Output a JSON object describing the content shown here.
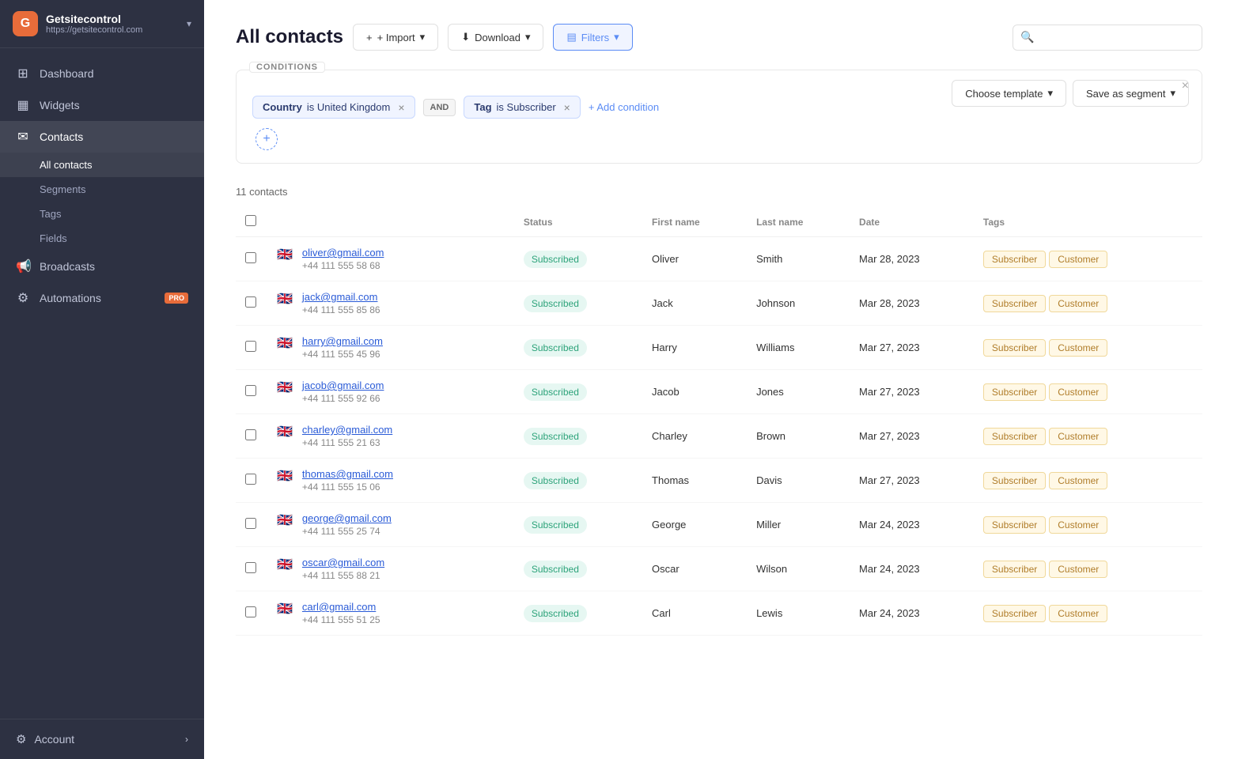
{
  "brand": {
    "name": "Getsitecontrol",
    "url": "https://getsitecontrol.com",
    "icon_label": "G"
  },
  "sidebar": {
    "nav_items": [
      {
        "id": "dashboard",
        "label": "Dashboard",
        "icon": "⊞"
      },
      {
        "id": "widgets",
        "label": "Widgets",
        "icon": "▦"
      },
      {
        "id": "contacts",
        "label": "Contacts",
        "icon": "✉",
        "active": true
      }
    ],
    "contacts_sub": [
      {
        "id": "all-contacts",
        "label": "All contacts",
        "active": true
      },
      {
        "id": "segments",
        "label": "Segments"
      },
      {
        "id": "tags",
        "label": "Tags"
      },
      {
        "id": "fields",
        "label": "Fields"
      }
    ],
    "nav_bottom": [
      {
        "id": "broadcasts",
        "label": "Broadcasts",
        "icon": "📢"
      },
      {
        "id": "automations",
        "label": "Automations",
        "icon": "⚙",
        "pro": true
      }
    ],
    "account": {
      "label": "Account",
      "icon": "⚙"
    }
  },
  "header": {
    "title": "All contacts",
    "import_label": "+ Import",
    "download_label": "⬇ Download",
    "filters_label": "⊞ Filters",
    "search_placeholder": ""
  },
  "conditions": {
    "label": "CONDITIONS",
    "choose_template": "Choose template",
    "save_as_segment": "Save as segment",
    "condition1": {
      "field": "Country",
      "operator": "is",
      "value": "United Kingdom"
    },
    "and_label": "AND",
    "condition2": {
      "field": "Tag",
      "operator": "is",
      "value": "Subscriber"
    },
    "add_condition_label": "+ Add condition"
  },
  "table": {
    "contact_count": "11 contacts",
    "columns": [
      "",
      "Status",
      "First name",
      "Last name",
      "Date",
      "Tags"
    ],
    "rows": [
      {
        "email": "oliver@gmail.com",
        "phone": "+44 111 555 58 68",
        "status": "Subscribed",
        "first_name": "Oliver",
        "last_name": "Smith",
        "date": "Mar 28, 2023",
        "tags": [
          "Subscriber",
          "Customer"
        ]
      },
      {
        "email": "jack@gmail.com",
        "phone": "+44 111 555 85 86",
        "status": "Subscribed",
        "first_name": "Jack",
        "last_name": "Johnson",
        "date": "Mar 28, 2023",
        "tags": [
          "Subscriber",
          "Customer"
        ]
      },
      {
        "email": "harry@gmail.com",
        "phone": "+44 111 555 45 96",
        "status": "Subscribed",
        "first_name": "Harry",
        "last_name": "Williams",
        "date": "Mar 27, 2023",
        "tags": [
          "Subscriber",
          "Customer"
        ]
      },
      {
        "email": "jacob@gmail.com",
        "phone": "+44 111 555 92 66",
        "status": "Subscribed",
        "first_name": "Jacob",
        "last_name": "Jones",
        "date": "Mar 27, 2023",
        "tags": [
          "Subscriber",
          "Customer"
        ]
      },
      {
        "email": "charley@gmail.com",
        "phone": "+44 111 555 21 63",
        "status": "Subscribed",
        "first_name": "Charley",
        "last_name": "Brown",
        "date": "Mar 27, 2023",
        "tags": [
          "Subscriber",
          "Customer"
        ]
      },
      {
        "email": "thomas@gmail.com",
        "phone": "+44 111 555 15 06",
        "status": "Subscribed",
        "first_name": "Thomas",
        "last_name": "Davis",
        "date": "Mar 27, 2023",
        "tags": [
          "Subscriber",
          "Customer"
        ]
      },
      {
        "email": "george@gmail.com",
        "phone": "+44 111 555 25 74",
        "status": "Subscribed",
        "first_name": "George",
        "last_name": "Miller",
        "date": "Mar 24, 2023",
        "tags": [
          "Subscriber",
          "Customer"
        ]
      },
      {
        "email": "oscar@gmail.com",
        "phone": "+44 111 555 88 21",
        "status": "Subscribed",
        "first_name": "Oscar",
        "last_name": "Wilson",
        "date": "Mar 24, 2023",
        "tags": [
          "Subscriber",
          "Customer"
        ]
      },
      {
        "email": "carl@gmail.com",
        "phone": "+44 111 555 51 25",
        "status": "Subscribed",
        "first_name": "Carl",
        "last_name": "Lewis",
        "date": "Mar 24, 2023",
        "tags": [
          "Subscriber",
          "Customer"
        ]
      }
    ]
  }
}
